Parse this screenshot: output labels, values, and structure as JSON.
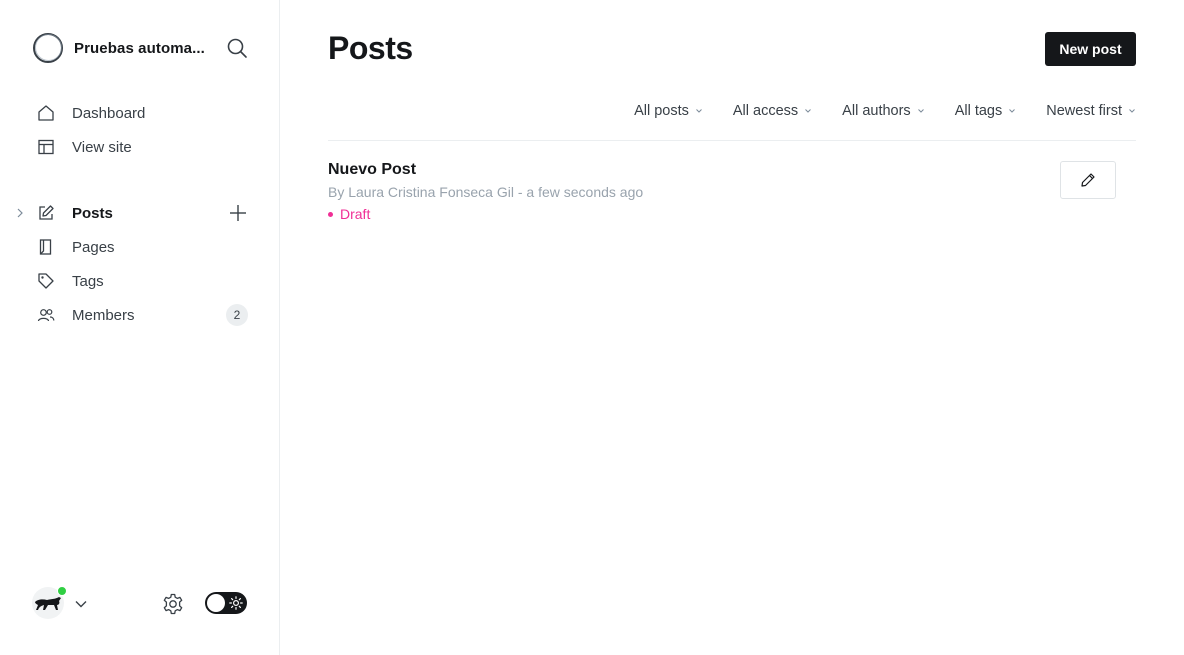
{
  "brand": {
    "title": "Pruebas automa..."
  },
  "sidebar": {
    "primary": [
      {
        "label": "Dashboard",
        "icon": "home-icon"
      },
      {
        "label": "View site",
        "icon": "layout-icon"
      }
    ],
    "secondary": [
      {
        "label": "Posts",
        "icon": "pencil-square-icon",
        "active": true
      },
      {
        "label": "Pages",
        "icon": "page-icon"
      },
      {
        "label": "Tags",
        "icon": "tag-icon"
      },
      {
        "label": "Members",
        "icon": "members-icon",
        "badge": "2"
      }
    ]
  },
  "main": {
    "title": "Posts",
    "new_post_label": "New post",
    "filters": [
      "All posts",
      "All access",
      "All authors",
      "All tags",
      "Newest first"
    ],
    "posts": [
      {
        "title": "Nuevo Post",
        "meta": "By Laura Cristina Fonseca Gil - a few seconds ago",
        "status": "Draft"
      }
    ]
  },
  "colors": {
    "accent_dark": "#15171a",
    "draft_pink": "#f02f96",
    "online_green": "#30cf43",
    "muted_text": "#99a3ad"
  }
}
